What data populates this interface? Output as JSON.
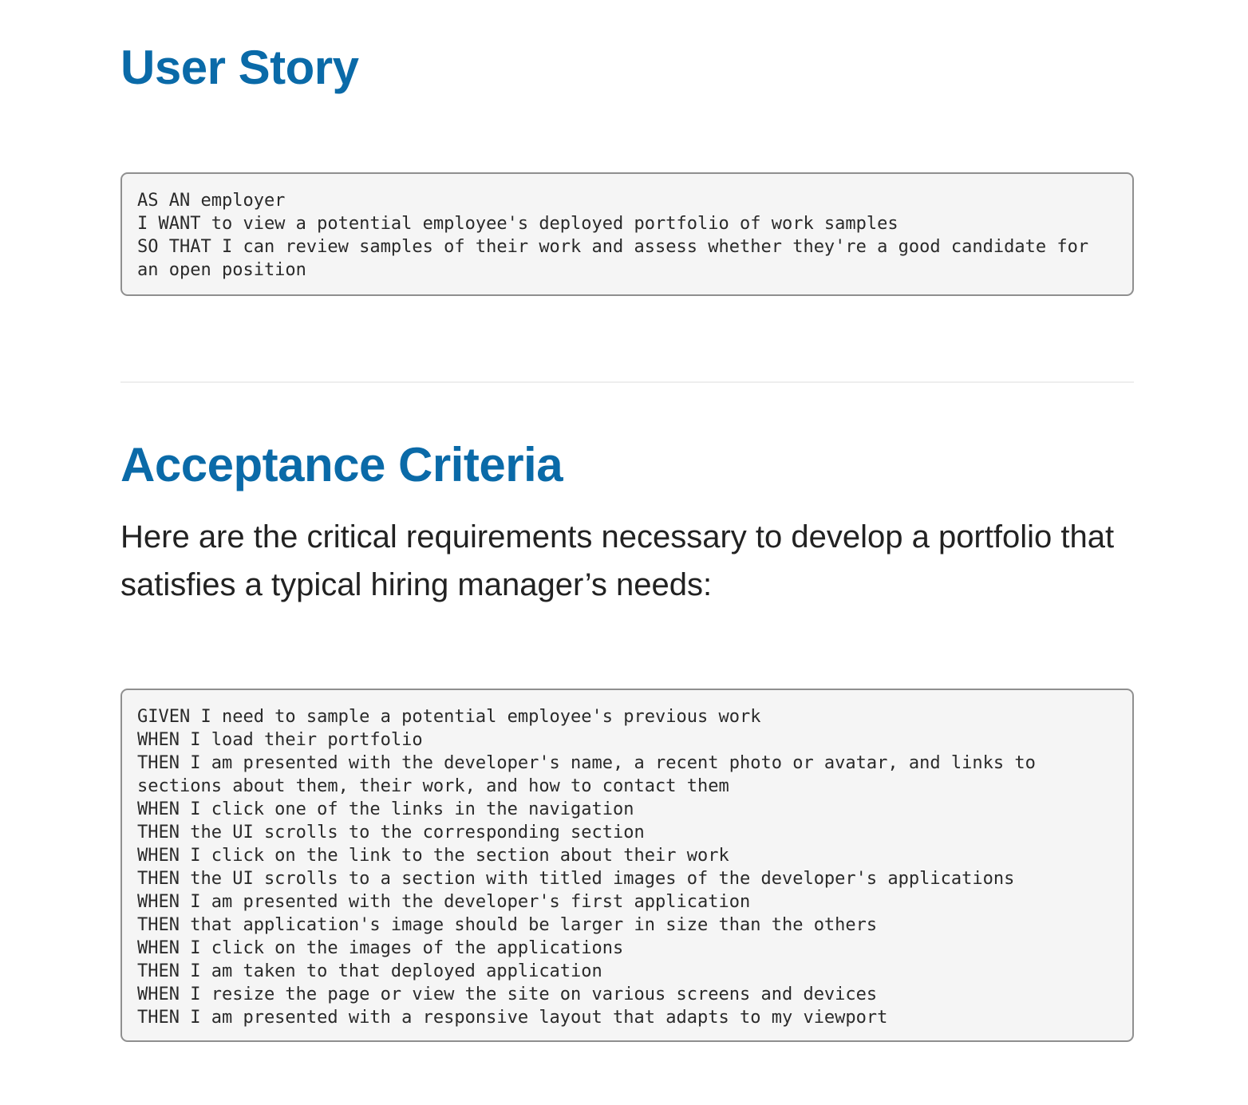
{
  "user_story": {
    "title": "User Story",
    "lines": [
      "AS AN employer",
      "I WANT to view a potential employee's deployed portfolio of work samples",
      "SO THAT I can review samples of their work and assess whether they're a good candidate for an open position"
    ]
  },
  "acceptance_criteria": {
    "title": "Acceptance Criteria",
    "intro": "Here are the critical requirements necessary to develop a portfolio that satisfies a typical hiring manager’s needs:",
    "lines": [
      "GIVEN I need to sample a potential employee's previous work",
      "WHEN I load their portfolio",
      "THEN I am presented with the developer's name, a recent photo or avatar, and links to sections about them, their work, and how to contact them",
      "WHEN I click one of the links in the navigation",
      "THEN the UI scrolls to the corresponding section",
      "WHEN I click on the link to the section about their work",
      "THEN the UI scrolls to a section with titled images of the developer's applications",
      "WHEN I am presented with the developer's first application",
      "THEN that application's image should be larger in size than the others",
      "WHEN I click on the images of the applications",
      "THEN I am taken to that deployed application",
      "WHEN I resize the page or view the site on various screens and devices",
      "THEN I am presented with a responsive layout that adapts to my viewport"
    ]
  }
}
